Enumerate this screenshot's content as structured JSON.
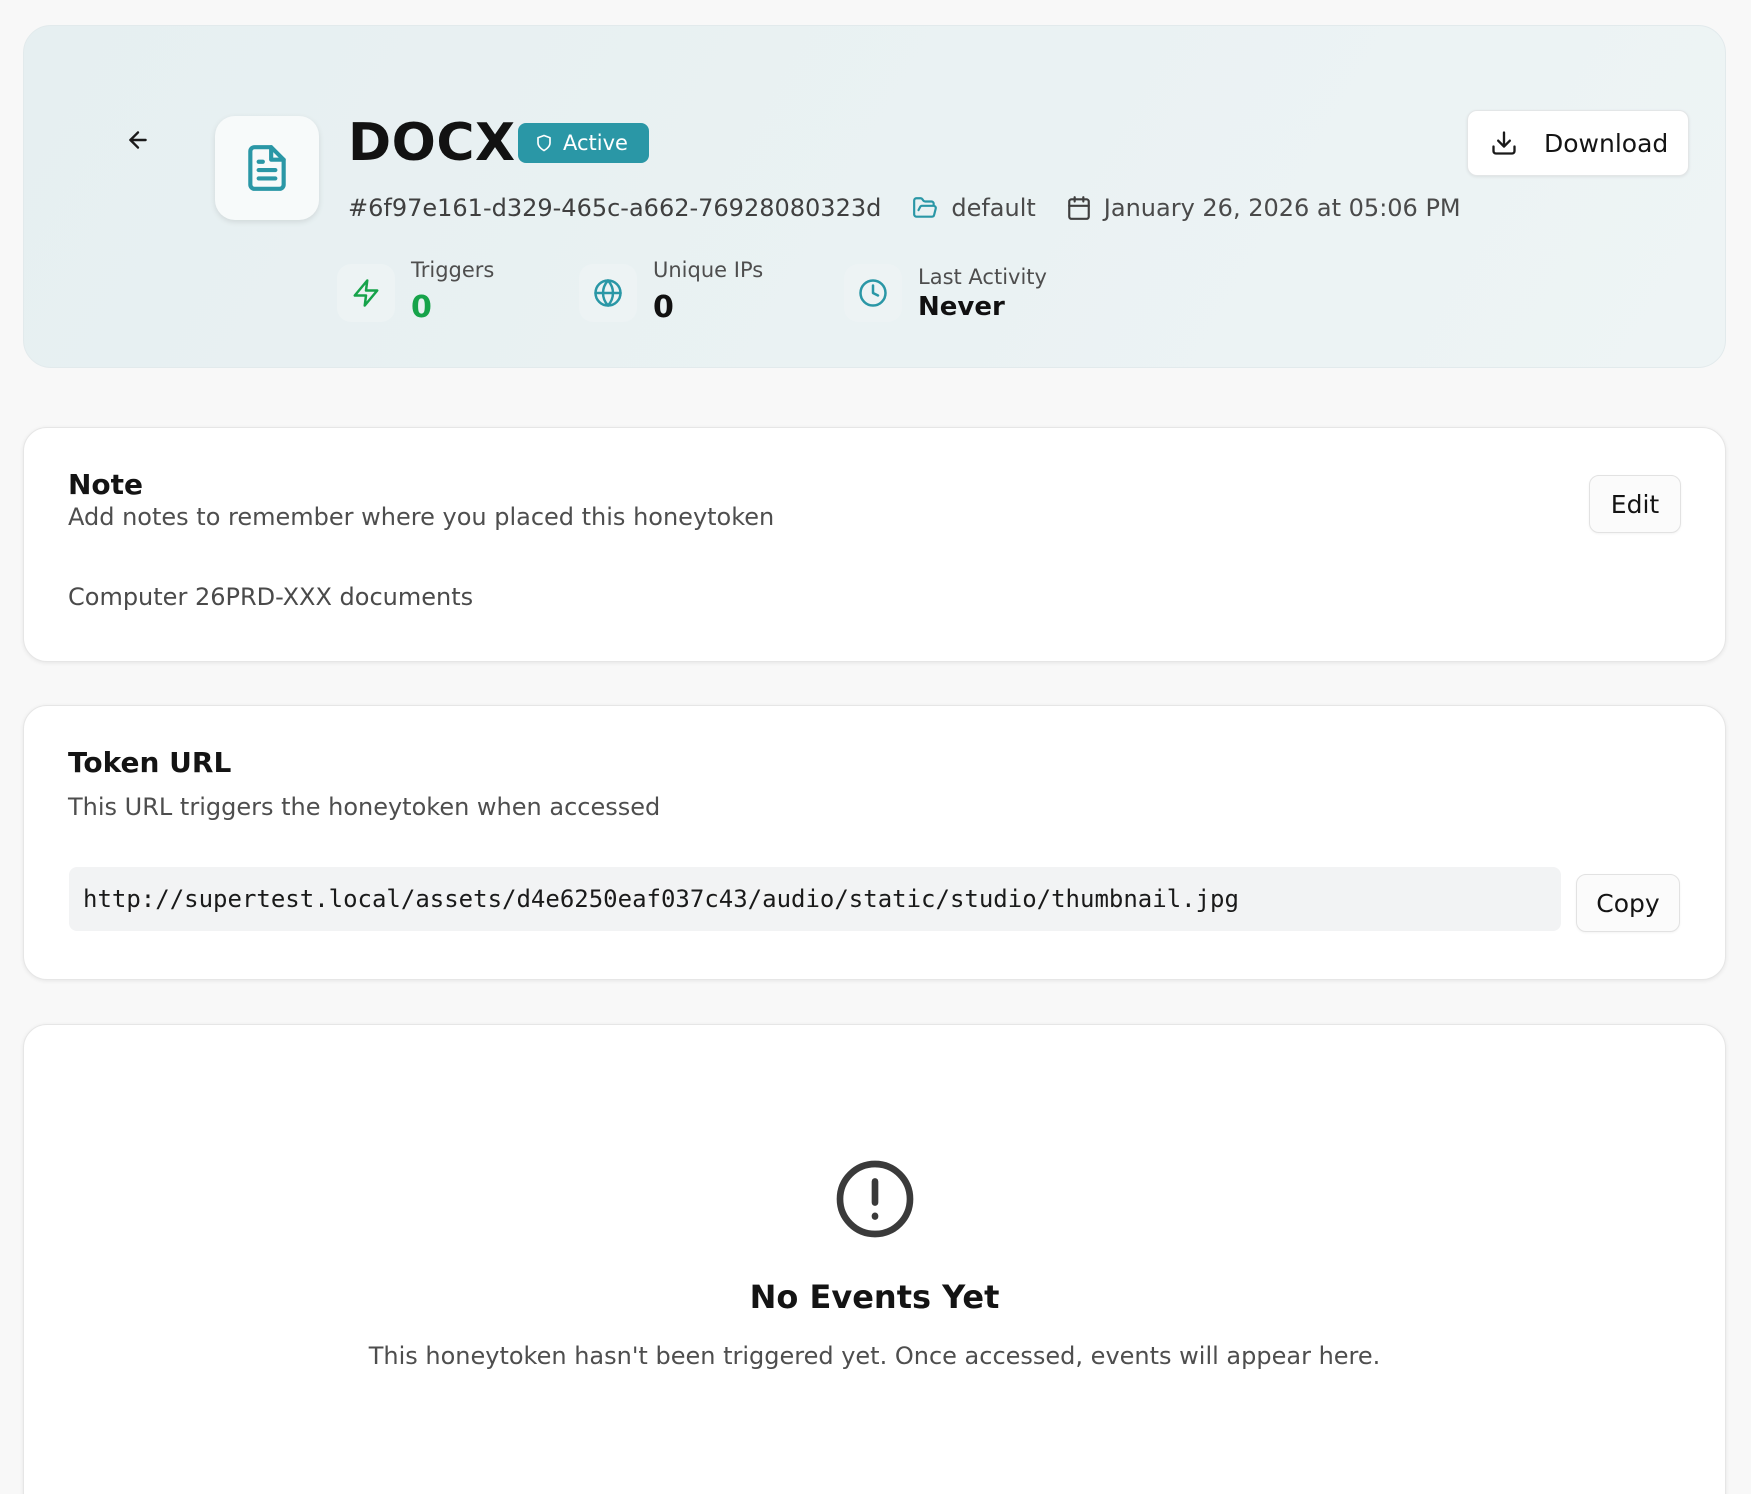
{
  "token": {
    "type_title": "DOCX",
    "status_badge": "Active",
    "id": "#6f97e161-d329-465c-a662-76928080323d",
    "folder": "default",
    "created": "January 26, 2026 at 05:06 PM"
  },
  "actions": {
    "download_label": "Download"
  },
  "stats": {
    "triggers": {
      "label": "Triggers",
      "value": "0"
    },
    "unique_ips": {
      "label": "Unique IPs",
      "value": "0"
    },
    "last_activity": {
      "label": "Last Activity",
      "value": "Never"
    }
  },
  "note": {
    "title": "Note",
    "subtitle": "Add notes to remember where you placed this honeytoken",
    "edit_label": "Edit",
    "content": "Computer 26PRD-XXX documents"
  },
  "token_url": {
    "title": "Token URL",
    "subtitle": "This URL triggers the honeytoken when accessed",
    "url": "http://supertest.local/assets/d4e6250eaf037c43/audio/static/studio/thumbnail.jpg",
    "copy_label": "Copy"
  },
  "events": {
    "empty_title": "No Events Yet",
    "empty_text": "This honeytoken hasn't been triggered yet. Once accessed, events will appear here."
  },
  "colors": {
    "accent": "#2a97a6",
    "triggers_value": "#16a34a",
    "background": "#f8f8f8"
  },
  "icons": {
    "back": "arrow-left-icon",
    "file": "file-text-icon",
    "badge": "shield-icon",
    "download": "download-icon",
    "folder": "folder-open-icon",
    "calendar": "calendar-icon",
    "triggers": "zap-icon",
    "unique_ips": "globe-icon",
    "last_activity": "clock-icon",
    "empty": "alert-circle-icon"
  }
}
